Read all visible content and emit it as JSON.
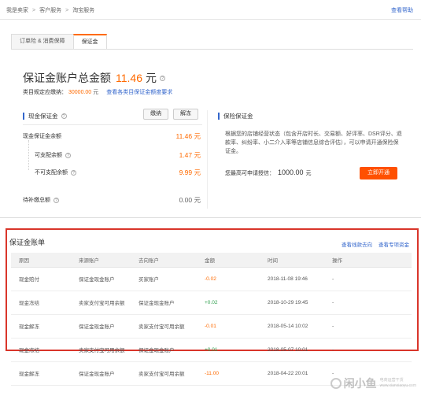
{
  "breadcrumb": [
    "我是卖家",
    "客户服务",
    "淘宝服务"
  ],
  "help_link": "查看帮助",
  "tabs": [
    {
      "label": "订单险 & 消费保障"
    },
    {
      "label": "保证金"
    }
  ],
  "account": {
    "title": "保证金账户总金额",
    "amount": "11.46",
    "unit": "元",
    "required_label": "类目规定应缴纳：",
    "required_value": "30000.00",
    "required_unit": "元",
    "required_link": "查看各类目保证金额度要求"
  },
  "cash": {
    "title": "现金保证金",
    "pay_label": "缴纳",
    "release_label": "解冻",
    "balance_label": "现金保证金余额",
    "balance_value": "11.46 元",
    "available_label": "可支配余额",
    "available_value": "1.47 元",
    "unavailable_label": "不可支配余额",
    "unavailable_value": "9.99 元",
    "pending_label": "待补缴总额",
    "pending_value": "0.00 元"
  },
  "insurance": {
    "title": "保险保证金",
    "description": "根据您的店铺经营状态（包含开店时长、交易额、好评率、DSR评分、退款率、纠纷率、小二介入率等店铺信息综合评估），可以申请开通保险保证金。",
    "limit_label": "您最高可申请授信：",
    "limit_value": "1000.00",
    "limit_unit": "元",
    "open_label": "立即开通"
  },
  "bill": {
    "title": "保证金账单",
    "link_query": "查看线款去向",
    "link_detail": "查看专项资金",
    "columns": [
      "原因",
      "来源账户",
      "去向账户",
      "金额",
      "时间",
      "操作"
    ],
    "rows": [
      {
        "reason": "现金赔付",
        "from": "保证金现金账户",
        "to": "买家账户",
        "amount": "-0.02",
        "time": "2018-11-08 19:46",
        "op": "-"
      },
      {
        "reason": "现金冻结",
        "from": "卖家支付宝可用余额",
        "to": "保证金现金账户",
        "amount": "+0.02",
        "time": "2018-10-29 19:45",
        "op": "-"
      },
      {
        "reason": "现金解冻",
        "from": "保证金现金账户",
        "to": "卖家支付宝可用余额",
        "amount": "-0.01",
        "time": "2018-05-14 10:02",
        "op": "-"
      },
      {
        "reason": "现金冻结",
        "from": "卖家支付宝可用余额",
        "to": "保证金现金账户",
        "amount": "+0.01",
        "time": "2018-05-07 10:01",
        "op": "-"
      },
      {
        "reason": "现金解冻",
        "from": "保证金现金账户",
        "to": "卖家支付宝可用余额",
        "amount": "-11.00",
        "time": "2018-04-22 20:01",
        "op": "-"
      }
    ]
  },
  "watermark": {
    "brand": "闲小鱼",
    "sub1": "电商运营干货",
    "sub2": "www.xianxiaoyu.com"
  },
  "colors": {
    "accent": "#ff6a00",
    "link": "#3366cc",
    "highlight_box": "#d9352a",
    "primary_button": "#ff5000"
  }
}
